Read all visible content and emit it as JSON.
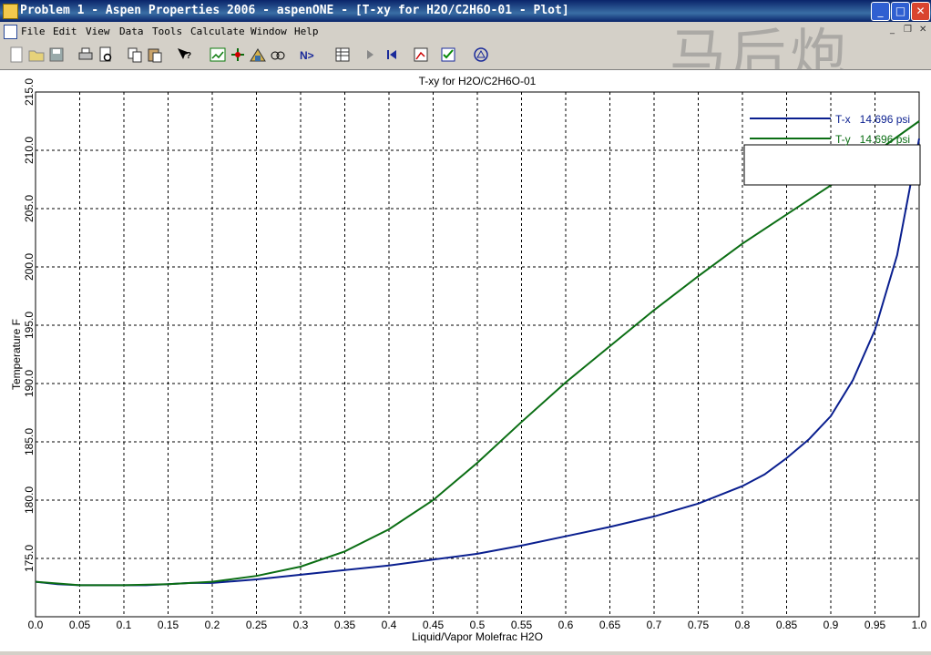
{
  "window": {
    "title": "Problem 1 - Aspen Properties 2006 - aspenONE - [T-xy for H2O/C2H6O-01 - Plot]",
    "controls": {
      "minimize": "_",
      "maximize": "□",
      "close": "✕"
    },
    "mdi_controls": {
      "minimize": "_",
      "restore": "❐",
      "close": "✕"
    }
  },
  "menu": [
    "File",
    "Edit",
    "View",
    "Data",
    "Tools",
    "Calculate",
    "Window",
    "Help"
  ],
  "toolbar": {
    "icons": [
      "new-icon",
      "open-icon",
      "save-icon",
      "print-icon",
      "print-preview-icon",
      "copy-icon",
      "paste-icon",
      "whats-this-help-icon",
      "data-browser-icon",
      "flowsheet-icon",
      "properties-icon",
      "analysis-icon",
      "next-icon",
      "results-table-icon",
      "play-icon",
      "rewind-icon",
      "plot-wizard-icon",
      "check-results-icon",
      "model-library-icon"
    ],
    "next_label": "N>"
  },
  "watermark": "马后炮",
  "chart_data": {
    "type": "line",
    "title": "T-xy for H2O/C2H6O-01",
    "xlabel": "Liquid/Vapor Molefrac H2O",
    "ylabel": "Temperature F",
    "xlim": [
      0.0,
      1.0
    ],
    "ylim": [
      170.0,
      215.0
    ],
    "xticks": [
      "0.0",
      "0.05",
      "0.1",
      "0.15",
      "0.2",
      "0.25",
      "0.3",
      "0.35",
      "0.4",
      "0.45",
      "0.5",
      "0.55",
      "0.6",
      "0.65",
      "0.7",
      "0.75",
      "0.8",
      "0.85",
      "0.9",
      "0.95",
      "1.0"
    ],
    "yticks": [
      "175.0",
      "180.0",
      "185.0",
      "190.0",
      "195.0",
      "200.0",
      "205.0",
      "210.0",
      "215.0"
    ],
    "grid": true,
    "legend_position": "top-right",
    "series": [
      {
        "name": "T-x   14.696 psi",
        "color": "#0a1f8f",
        "x": [
          0.0,
          0.025,
          0.05,
          0.075,
          0.1,
          0.125,
          0.15,
          0.175,
          0.2,
          0.25,
          0.3,
          0.35,
          0.4,
          0.45,
          0.5,
          0.55,
          0.6,
          0.65,
          0.7,
          0.75,
          0.8,
          0.825,
          0.85,
          0.875,
          0.9,
          0.925,
          0.95,
          0.975,
          1.0
        ],
        "y": [
          173.0,
          172.8,
          172.7,
          172.7,
          172.7,
          172.7,
          172.8,
          172.9,
          172.9,
          173.2,
          173.6,
          174.0,
          174.4,
          174.9,
          175.4,
          176.1,
          176.9,
          177.7,
          178.6,
          179.7,
          181.2,
          182.2,
          183.6,
          185.2,
          187.2,
          190.3,
          194.6,
          201.0,
          211.0
        ]
      },
      {
        "name": "T-y   14.696 psi",
        "color": "#0b6e14",
        "x": [
          0.0,
          0.05,
          0.1,
          0.15,
          0.2,
          0.25,
          0.3,
          0.35,
          0.4,
          0.45,
          0.5,
          0.55,
          0.6,
          0.65,
          0.7,
          0.75,
          0.8,
          0.85,
          0.9,
          0.95,
          1.0
        ],
        "y": [
          173.0,
          172.7,
          172.7,
          172.8,
          173.0,
          173.5,
          174.3,
          175.6,
          177.5,
          180.0,
          183.2,
          186.7,
          190.1,
          193.2,
          196.3,
          199.2,
          202.0,
          204.5,
          207.0,
          209.8,
          212.5
        ]
      }
    ]
  }
}
